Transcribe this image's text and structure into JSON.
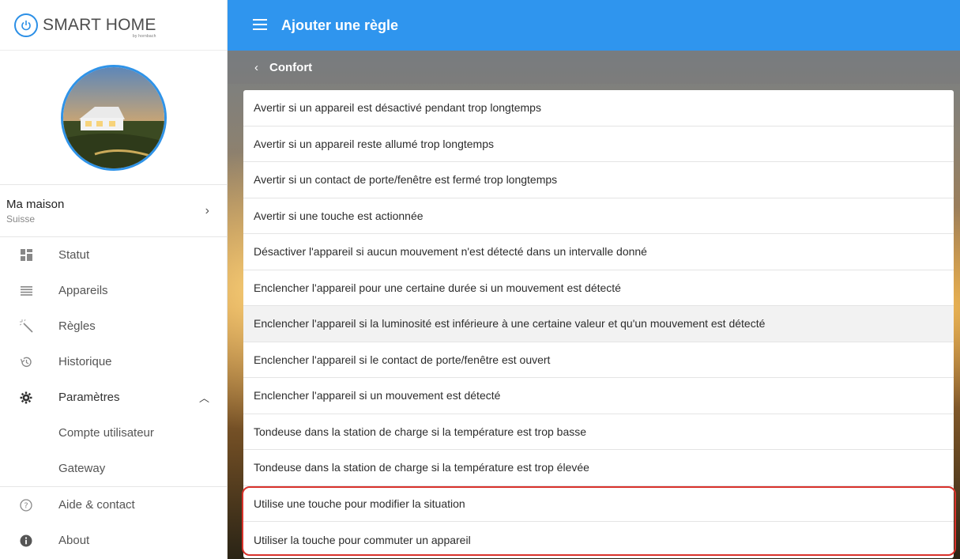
{
  "brand": {
    "name": "SMART HOME",
    "sub": "by hornbach",
    "accent": "#2f95ee"
  },
  "sidebar": {
    "home": {
      "name": "Ma maison",
      "country": "Suisse"
    },
    "nav": [
      {
        "label": "Statut",
        "icon": "dashboard-icon"
      },
      {
        "label": "Appareils",
        "icon": "list-icon"
      },
      {
        "label": "Règles",
        "icon": "magic-wand-icon"
      },
      {
        "label": "Historique",
        "icon": "history-icon"
      }
    ],
    "settings": {
      "label": "Paramètres",
      "sub": [
        "Compte utilisateur",
        "Gateway"
      ]
    },
    "help": "Aide & contact",
    "about": "About"
  },
  "header": {
    "title": "Ajouter une règle"
  },
  "subheader": {
    "title": "Confort"
  },
  "rules": [
    "Avertir si un appareil est désactivé pendant trop longtemps",
    "Avertir si un appareil reste allumé trop longtemps",
    "Avertir si un contact de porte/fenêtre est fermé trop longtemps",
    "Avertir si une touche est actionnée",
    "Désactiver l'appareil si aucun mouvement n'est détecté dans un intervalle donné",
    "Enclencher l'appareil pour une certaine durée si un mouvement est détecté",
    "Enclencher l'appareil si la luminosité est inférieure à une certaine valeur et qu'un mouvement est détecté",
    "Enclencher l'appareil si le contact de porte/fenêtre est ouvert",
    "Enclencher l'appareil si un mouvement est détecté",
    "Tondeuse dans la station de charge si la température est trop basse",
    "Tondeuse dans la station de charge si la température est trop élevée",
    "Utilise une touche pour modifier la situation",
    "Utiliser la touche pour commuter un appareil"
  ],
  "callout_color": "#d9322b"
}
